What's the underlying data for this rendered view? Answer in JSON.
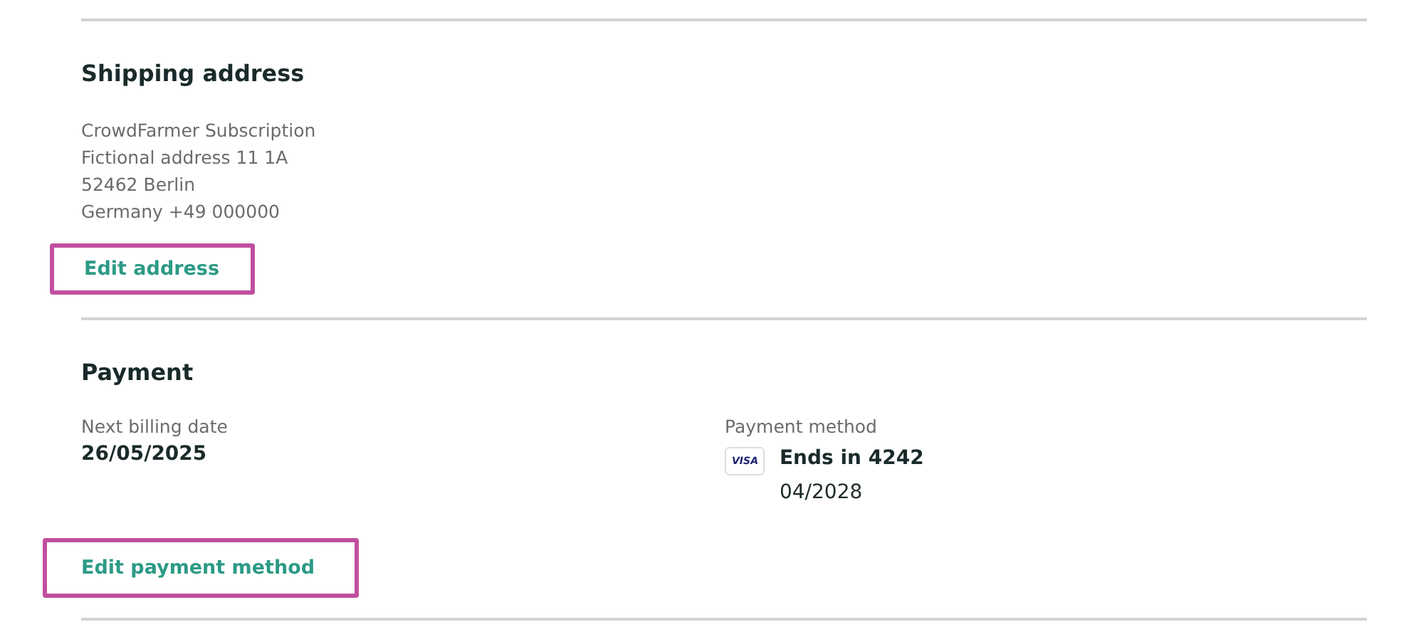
{
  "shipping": {
    "title": "Shipping address",
    "address_lines": [
      "CrowdFarmer Subscription",
      "Fictional address 11 1A",
      "52462 Berlin",
      "Germany +49 000000"
    ],
    "edit_button": "Edit address"
  },
  "payment": {
    "title": "Payment",
    "billing_label": "Next billing date",
    "billing_date": "26/05/2025",
    "method_label": "Payment method",
    "card_brand": "VISA",
    "card_ending": "Ends in 4242",
    "card_expiry": "04/2028",
    "edit_button": "Edit payment method"
  }
}
